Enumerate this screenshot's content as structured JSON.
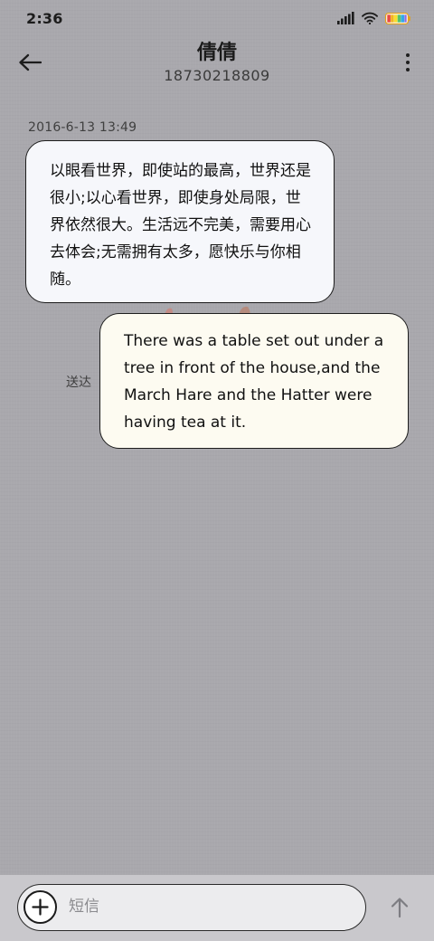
{
  "status_bar": {
    "time": "2:36",
    "icons": [
      "signal-icon",
      "wifi-icon",
      "battery-icon"
    ]
  },
  "header": {
    "back_icon": "arrow-left-icon",
    "contact_name": "倩倩",
    "contact_number": "18730218809",
    "more_icon": "more-vertical-icon"
  },
  "conversation": {
    "timestamp": "2016-6-13 13:49",
    "messages": [
      {
        "direction": "received",
        "text": "以眼看世界，即使站的最高，世界还是很小;以心看世界，即使身处局限，世界依然很大。生活远不完美，需要用心去体会;无需拥有太多，愿快乐与你相随。"
      },
      {
        "direction": "sent",
        "text": "There was a table set out under a tree in front of the house,and the March Hare and the Hatter were having tea at it.",
        "status": "送达"
      }
    ]
  },
  "composer": {
    "add_icon": "plus-circle-icon",
    "placeholder": "短信",
    "value": "",
    "send_icon": "arrow-up-icon"
  },
  "colors": {
    "background": "#a9a8ad",
    "received_bubble": "#f6f7fb",
    "sent_bubble": "#fdfbf1",
    "composer_bar": "#c9c8cc",
    "outline": "#1d1d1d"
  }
}
